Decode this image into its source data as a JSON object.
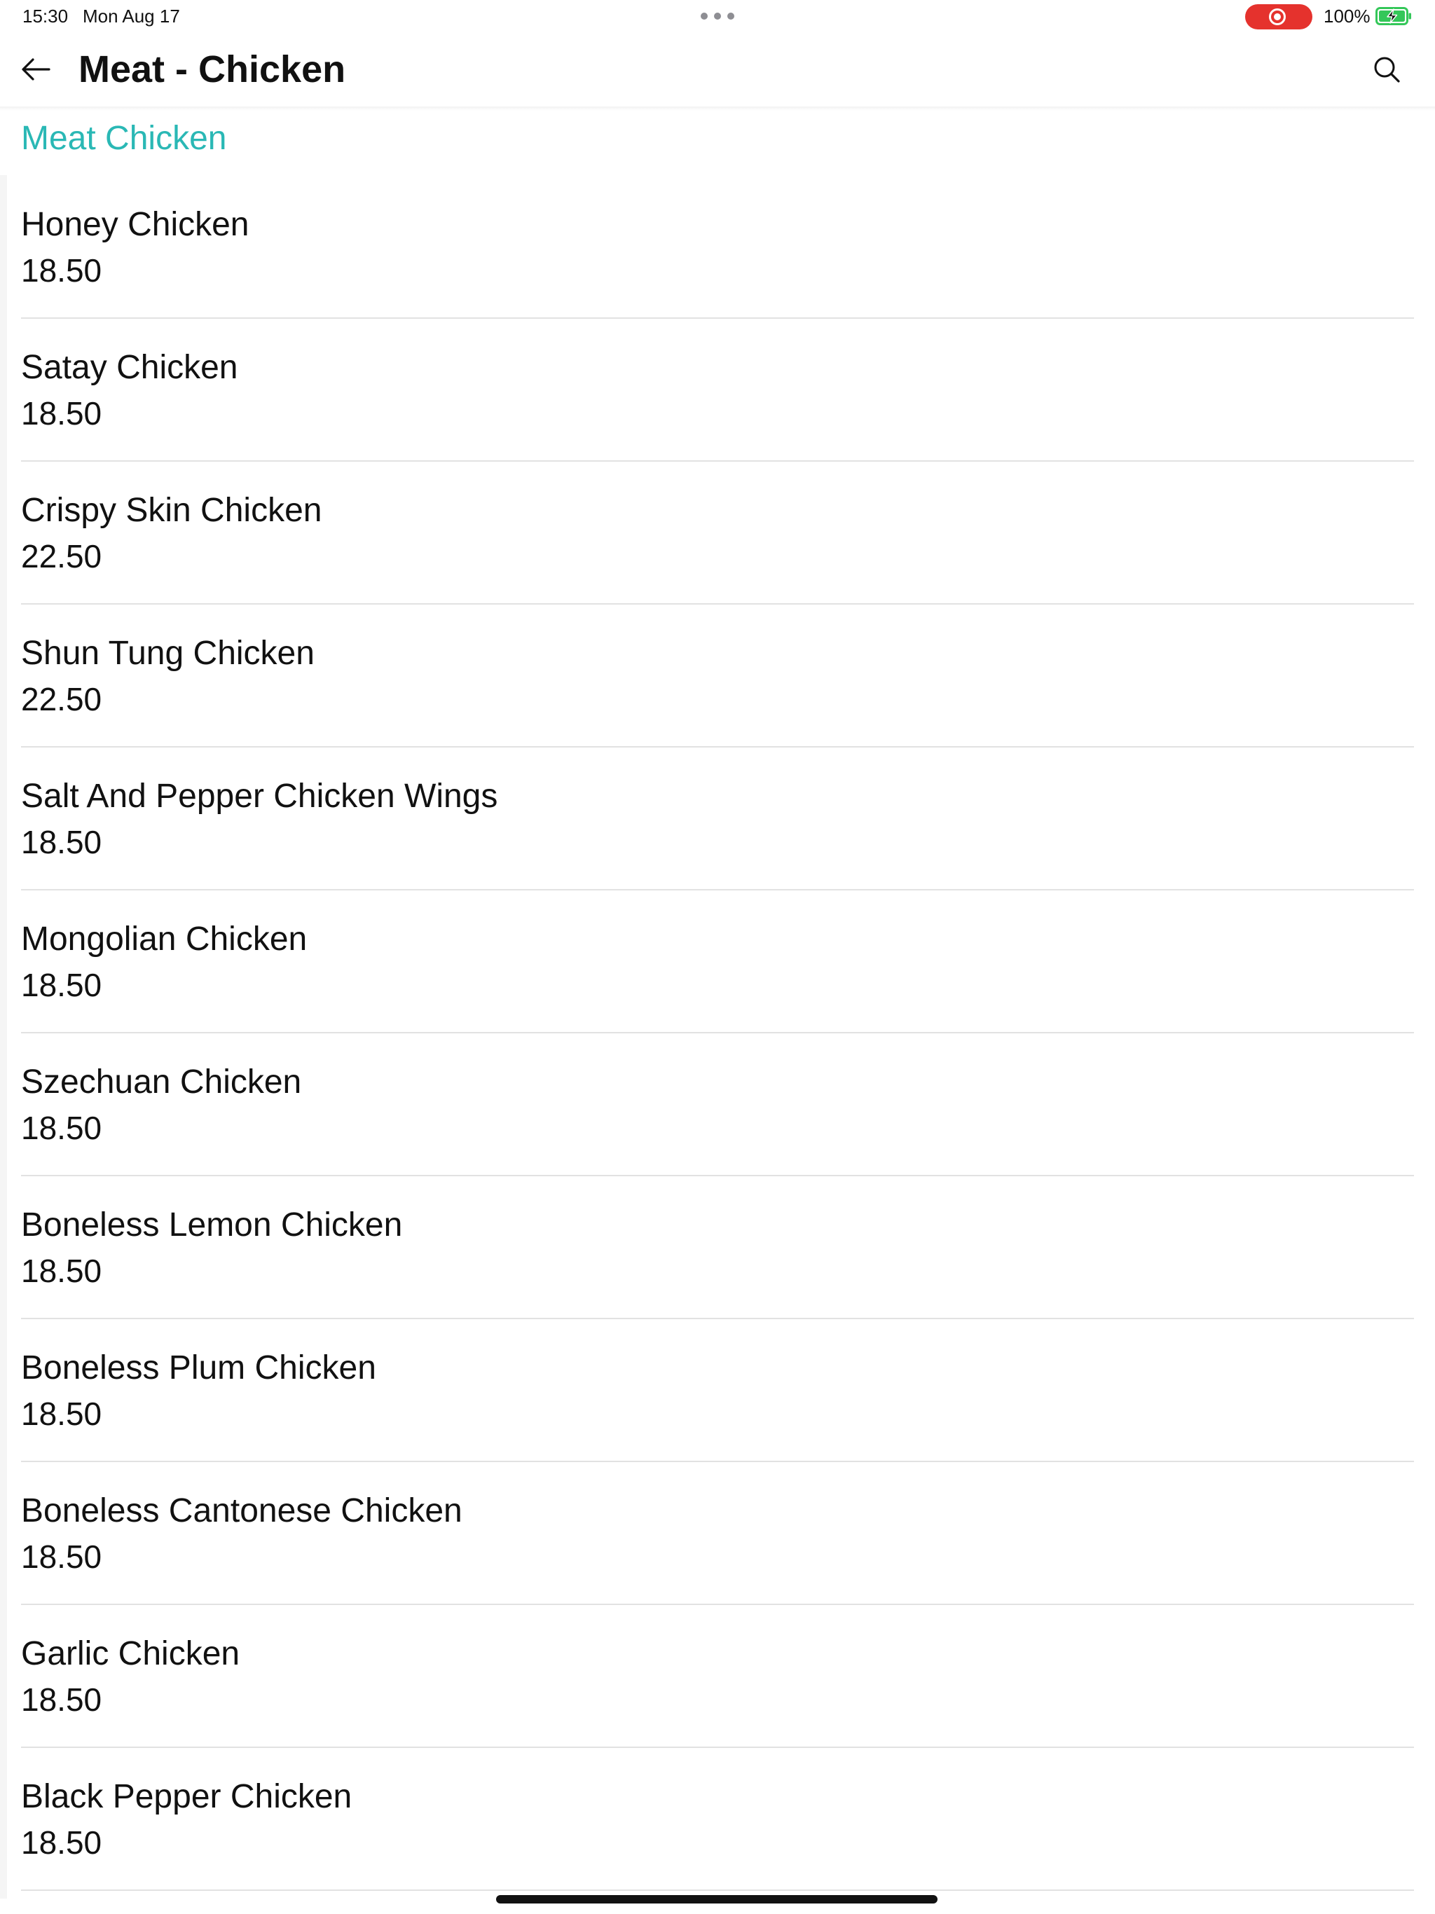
{
  "status_bar": {
    "time": "15:30",
    "date": "Mon Aug 17",
    "battery": "100%",
    "record_color": "#e5322d",
    "battery_color": "#34c759"
  },
  "header": {
    "title": "Meat - Chicken",
    "back_icon": "arrow-left-icon",
    "search_icon": "search-icon"
  },
  "section": {
    "title": "Meat Chicken",
    "accent_color": "#2ab8b5"
  },
  "items": [
    {
      "name": "Honey Chicken",
      "price": "18.50"
    },
    {
      "name": "Satay Chicken",
      "price": "18.50"
    },
    {
      "name": "Crispy Skin Chicken",
      "price": "22.50"
    },
    {
      "name": "Shun Tung Chicken",
      "price": "22.50"
    },
    {
      "name": "Salt And Pepper Chicken Wings",
      "price": "18.50"
    },
    {
      "name": "Mongolian Chicken",
      "price": "18.50"
    },
    {
      "name": "Szechuan Chicken",
      "price": "18.50"
    },
    {
      "name": "Boneless Lemon Chicken",
      "price": "18.50"
    },
    {
      "name": "Boneless Plum Chicken",
      "price": "18.50"
    },
    {
      "name": "Boneless Cantonese Chicken",
      "price": "18.50"
    },
    {
      "name": "Garlic Chicken",
      "price": "18.50"
    },
    {
      "name": "Black Pepper Chicken",
      "price": "18.50"
    }
  ]
}
